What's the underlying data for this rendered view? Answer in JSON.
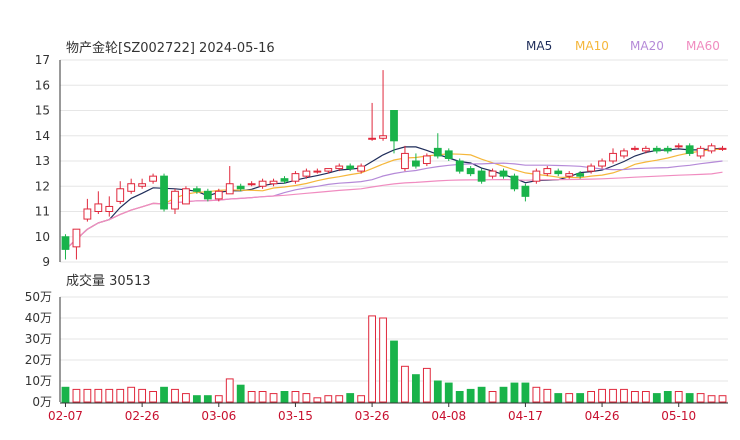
{
  "header": {
    "title": "物产金轮[SZ002722] 2024-05-16"
  },
  "legend": [
    {
      "label": "MA5",
      "color": "#1f2d5a"
    },
    {
      "label": "MA10",
      "color": "#f5b73b"
    },
    {
      "label": "MA20",
      "color": "#b58ad8"
    },
    {
      "label": "MA60",
      "color": "#f08cc0"
    }
  ],
  "volume_header": {
    "label": "成交量 30513"
  },
  "colors": {
    "up": "#e0283c",
    "down": "#19b34a",
    "grid": "#e6e6e6",
    "axis": "#333333"
  },
  "chart_data": [
    {
      "type": "candlestick",
      "title": "物产金轮[SZ002722] 2024-05-16",
      "ylim": [
        9,
        17
      ],
      "y_ticks": [
        "9",
        "10",
        "11",
        "12",
        "13",
        "14",
        "15",
        "16",
        "17"
      ],
      "x_tick_labels": [
        "02-07",
        "02-26",
        "03-06",
        "03-15",
        "03-26",
        "04-08",
        "04-17",
        "04-26",
        "05-10"
      ],
      "x_tick_index": [
        0,
        7,
        14,
        21,
        28,
        35,
        42,
        49,
        56
      ],
      "x": [
        "02-07",
        "02-08",
        "02-19",
        "02-20",
        "02-21",
        "02-22",
        "02-23",
        "02-26",
        "02-27",
        "02-28",
        "02-29",
        "03-01",
        "03-04",
        "03-05",
        "03-06",
        "03-07",
        "03-08",
        "03-11",
        "03-12",
        "03-13",
        "03-14",
        "03-15",
        "03-18",
        "03-19",
        "03-20",
        "03-21",
        "03-22",
        "03-25",
        "03-26",
        "03-27",
        "03-28",
        "03-29",
        "04-01",
        "04-02",
        "04-03",
        "04-08",
        "04-09",
        "04-10",
        "04-11",
        "04-12",
        "04-15",
        "04-16",
        "04-17",
        "04-18",
        "04-19",
        "04-22",
        "04-23",
        "04-24",
        "04-25",
        "04-26",
        "04-29",
        "04-30",
        "05-06",
        "05-07",
        "05-08",
        "05-09",
        "05-10",
        "05-13",
        "05-14",
        "05-15",
        "05-16"
      ],
      "open": [
        10.0,
        9.6,
        10.7,
        11.0,
        11.0,
        11.4,
        11.8,
        12.0,
        12.2,
        12.4,
        11.1,
        11.3,
        11.9,
        11.8,
        11.5,
        11.7,
        12.0,
        12.1,
        12.0,
        12.1,
        12.3,
        12.2,
        12.4,
        12.6,
        12.6,
        12.7,
        12.8,
        12.6,
        13.9,
        13.9,
        15.0,
        12.7,
        13.0,
        12.9,
        13.5,
        13.4,
        13.0,
        12.7,
        12.6,
        12.4,
        12.6,
        12.4,
        12.0,
        12.2,
        12.5,
        12.6,
        12.4,
        12.5,
        12.6,
        12.8,
        13.0,
        13.2,
        13.5,
        13.4,
        13.5,
        13.5,
        13.6,
        13.6,
        13.2,
        13.4,
        13.5
      ],
      "close": [
        9.5,
        10.3,
        11.1,
        11.3,
        11.2,
        11.9,
        12.1,
        12.1,
        12.4,
        11.1,
        11.8,
        11.9,
        11.8,
        11.5,
        11.8,
        12.1,
        11.9,
        12.1,
        12.2,
        12.2,
        12.2,
        12.5,
        12.6,
        12.6,
        12.7,
        12.8,
        12.7,
        12.8,
        13.9,
        14.0,
        13.8,
        13.3,
        12.8,
        13.2,
        13.2,
        13.1,
        12.6,
        12.5,
        12.2,
        12.6,
        12.4,
        11.9,
        11.6,
        12.6,
        12.7,
        12.5,
        12.5,
        12.4,
        12.8,
        13.0,
        13.3,
        13.4,
        13.5,
        13.5,
        13.4,
        13.4,
        13.6,
        13.3,
        13.5,
        13.6,
        13.5
      ],
      "high": [
        10.1,
        10.3,
        11.5,
        11.8,
        11.6,
        12.2,
        12.3,
        12.3,
        12.5,
        12.5,
        11.9,
        12.0,
        12.0,
        11.9,
        11.9,
        12.8,
        12.1,
        12.2,
        12.3,
        12.3,
        12.4,
        12.6,
        12.7,
        12.7,
        12.7,
        12.9,
        12.9,
        12.9,
        15.3,
        16.6,
        15.0,
        13.6,
        13.3,
        13.3,
        14.1,
        13.5,
        13.1,
        12.8,
        12.7,
        12.7,
        12.7,
        12.5,
        12.1,
        12.7,
        12.8,
        12.7,
        12.6,
        12.6,
        12.9,
        13.1,
        13.5,
        13.5,
        13.6,
        13.6,
        13.6,
        13.6,
        13.7,
        13.7,
        13.6,
        13.7,
        13.6
      ],
      "low": [
        9.1,
        9.1,
        10.6,
        10.9,
        10.8,
        11.3,
        11.7,
        11.9,
        12.1,
        11.0,
        10.9,
        11.3,
        11.7,
        11.4,
        11.4,
        11.7,
        11.8,
        12.0,
        11.9,
        12.0,
        12.1,
        12.1,
        12.3,
        12.5,
        12.5,
        12.6,
        12.6,
        12.5,
        13.8,
        13.8,
        13.3,
        12.6,
        12.7,
        12.8,
        13.1,
        13.0,
        12.5,
        12.4,
        12.1,
        12.3,
        12.3,
        11.8,
        11.4,
        12.1,
        12.4,
        12.4,
        12.3,
        12.3,
        12.5,
        12.7,
        12.9,
        13.1,
        13.4,
        13.3,
        13.3,
        13.3,
        13.5,
        13.2,
        13.1,
        13.3,
        13.4
      ]
    },
    {
      "type": "bar",
      "title": "成交量 30513",
      "ylim": [
        0,
        50
      ],
      "y_ticks": [
        "0万",
        "10万",
        "20万",
        "30万",
        "40万",
        "50万"
      ],
      "x": [
        "02-07",
        "02-08",
        "02-19",
        "02-20",
        "02-21",
        "02-22",
        "02-23",
        "02-26",
        "02-27",
        "02-28",
        "02-29",
        "03-01",
        "03-04",
        "03-05",
        "03-06",
        "03-07",
        "03-08",
        "03-11",
        "03-12",
        "03-13",
        "03-14",
        "03-15",
        "03-18",
        "03-19",
        "03-20",
        "03-21",
        "03-22",
        "03-25",
        "03-26",
        "03-27",
        "03-28",
        "03-29",
        "04-01",
        "04-02",
        "04-03",
        "04-08",
        "04-09",
        "04-10",
        "04-11",
        "04-12",
        "04-15",
        "04-16",
        "04-17",
        "04-18",
        "04-19",
        "04-22",
        "04-23",
        "04-24",
        "04-25",
        "04-26",
        "04-29",
        "04-30",
        "05-06",
        "05-07",
        "05-08",
        "05-09",
        "05-10",
        "05-13",
        "05-14",
        "05-15",
        "05-16"
      ],
      "values": [
        7,
        6,
        6,
        6,
        6,
        6,
        7,
        6,
        5,
        7,
        6,
        4,
        3,
        3,
        3,
        11,
        8,
        5,
        5,
        4,
        5,
        5,
        4,
        2,
        3,
        3,
        4,
        3,
        41,
        40,
        29,
        17,
        13,
        16,
        10,
        9,
        5,
        6,
        7,
        5,
        7,
        9,
        9,
        7,
        6,
        4,
        4,
        4,
        5,
        6,
        6,
        6,
        5,
        5,
        4,
        5,
        5,
        4,
        4,
        3,
        3
      ]
    }
  ]
}
